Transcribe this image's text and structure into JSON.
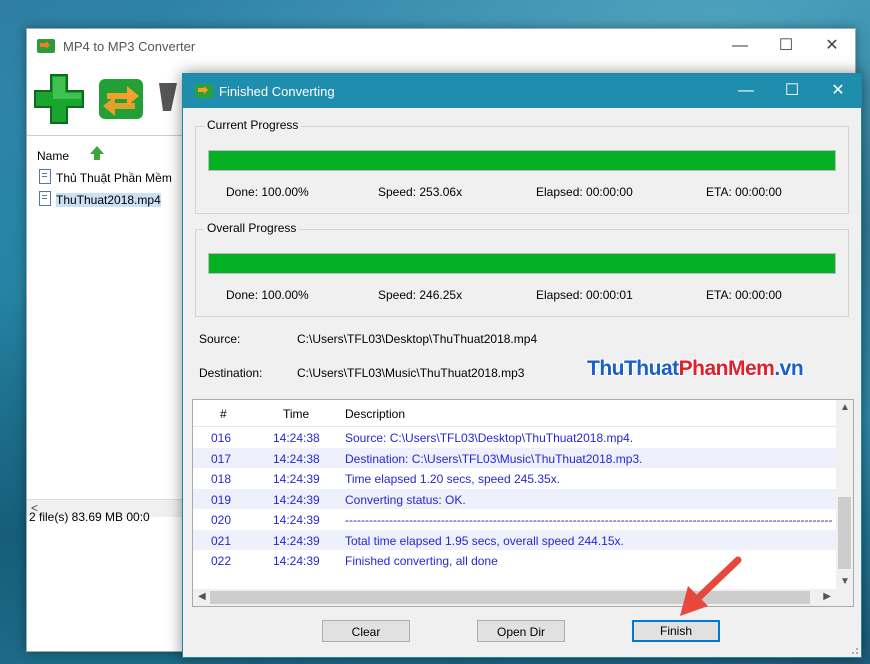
{
  "main_window": {
    "title": "MP4 to MP3 Converter",
    "controls": {
      "minimize": "—",
      "maximize": "☐",
      "close": "✕"
    },
    "list_header": "Name",
    "files": [
      {
        "name": "Thủ Thuật Phần Mềm"
      },
      {
        "name": "ThuThuat2018.mp4"
      }
    ],
    "status": "2 file(s)   83.69 MB   00:0"
  },
  "dialog": {
    "title": "Finished Converting",
    "controls": {
      "minimize": "—",
      "maximize": "☐",
      "close": "✕"
    },
    "current": {
      "label": "Current Progress",
      "progress": 1.0,
      "done": "Done:  100.00%",
      "speed": "Speed:  253.06x",
      "elapsed": "Elapsed:   00:00:00",
      "eta": "ETA:   00:00:00"
    },
    "overall": {
      "label": "Overall Progress",
      "progress": 1.0,
      "done": "Done:  100.00%",
      "speed": "Speed:  246.25x",
      "elapsed": "Elapsed:   00:00:01",
      "eta": "ETA:   00:00:00"
    },
    "source_label": "Source:",
    "source_value": "C:\\Users\\TFL03\\Desktop\\ThuThuat2018.mp4",
    "destination_label": "Destination:",
    "destination_value": "C:\\Users\\TFL03\\Music\\ThuThuat2018.mp3",
    "watermark": {
      "part1": "ThuThuat",
      "part2": "PhanMem",
      "part3": ".vn"
    },
    "log": {
      "columns": [
        "#",
        "Time",
        "Description"
      ],
      "rows": [
        {
          "num": "016",
          "time": "14:24:38",
          "desc": "Source:  C:\\Users\\TFL03\\Desktop\\ThuThuat2018.mp4."
        },
        {
          "num": "017",
          "time": "14:24:38",
          "desc": "Destination: C:\\Users\\TFL03\\Music\\ThuThuat2018.mp3."
        },
        {
          "num": "018",
          "time": "14:24:39",
          "desc": "Time elapsed 1.20 secs, speed 245.35x."
        },
        {
          "num": "019",
          "time": "14:24:39",
          "desc": "Converting status: OK."
        },
        {
          "num": "020",
          "time": "14:24:39",
          "desc": "----------------------------------------------------------------------------------------------------------------------------------------------------"
        },
        {
          "num": "021",
          "time": "14:24:39",
          "desc": "Total time elapsed 1.95 secs, overall speed 244.15x."
        },
        {
          "num": "022",
          "time": "14:24:39",
          "desc": "Finished converting, all done"
        }
      ]
    },
    "buttons": {
      "clear": "Clear",
      "open_dir": "Open Dir",
      "finish": "Finish"
    }
  },
  "colors": {
    "dialog_titlebar": "#1f8eae",
    "progress_fill": "#06b025",
    "log_text": "#2626d6",
    "watermark_blue": "#1b5fc9",
    "watermark_red": "#e0202e",
    "arrow": "#e8473b"
  }
}
